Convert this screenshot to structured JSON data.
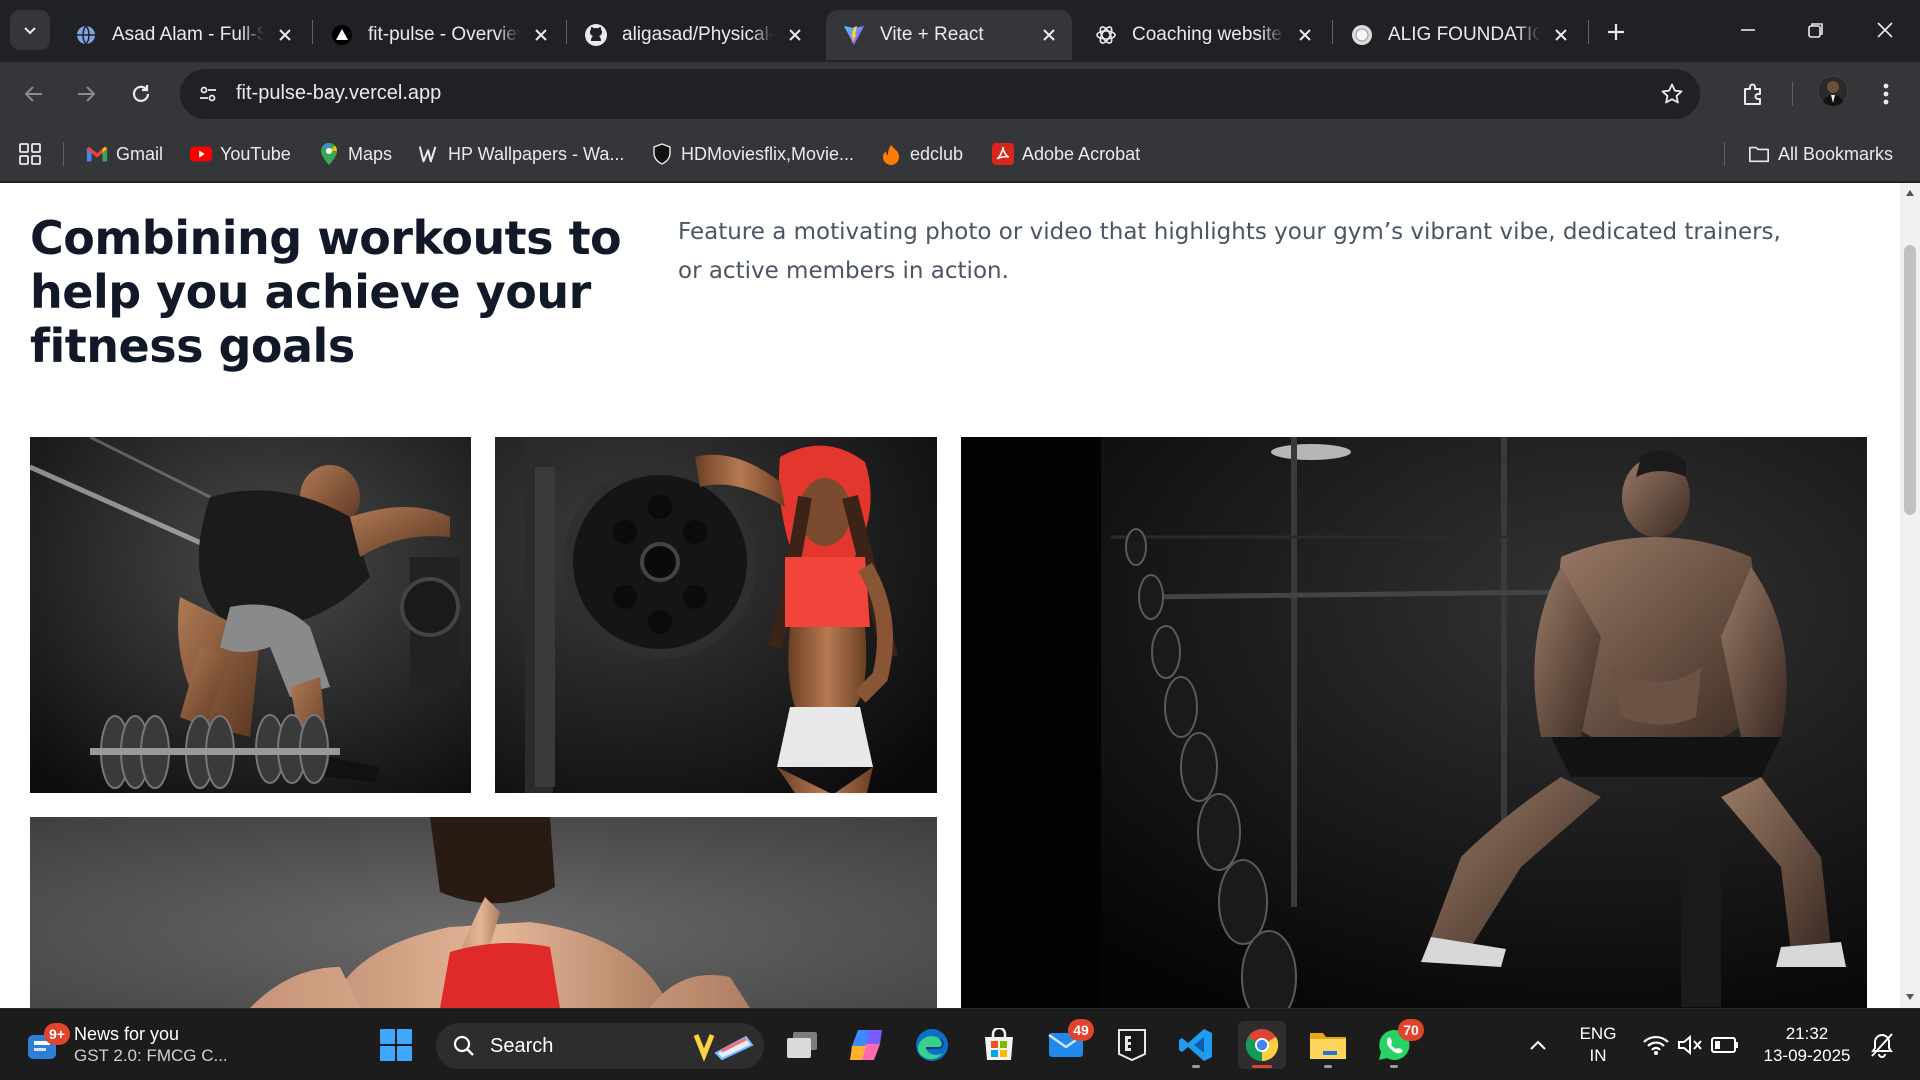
{
  "browser": {
    "tabs": [
      {
        "title": "Asad Alam - Full-Stack",
        "icon": "globe-icon",
        "active": false
      },
      {
        "title": "fit-pulse - Overview",
        "icon": "vercel-icon",
        "active": false
      },
      {
        "title": "aligasad/Physical-Fitness",
        "icon": "github-icon",
        "active": false
      },
      {
        "title": "Vite + React",
        "icon": "vite-icon",
        "active": true
      },
      {
        "title": "Coaching website ideas",
        "icon": "chatgpt-icon",
        "active": false
      },
      {
        "title": "ALIG FOUNDATION",
        "icon": "globe-icon",
        "active": false
      }
    ],
    "url": "fit-pulse-bay.vercel.app",
    "bookmarks": [
      {
        "label": "Gmail",
        "icon": "gmail-icon"
      },
      {
        "label": "YouTube",
        "icon": "youtube-icon"
      },
      {
        "label": "Maps",
        "icon": "maps-icon"
      },
      {
        "label": "HP Wallpapers - Wa...",
        "icon": "wallpaper-icon"
      },
      {
        "label": "HDMoviesflix,Movie...",
        "icon": "shield-icon"
      },
      {
        "label": "edclub",
        "icon": "edclub-icon"
      },
      {
        "label": "Adobe Acrobat",
        "icon": "acrobat-icon"
      }
    ],
    "all_bookmarks_label": "All Bookmarks"
  },
  "page": {
    "hero_title": "Combining workouts to help you achieve your fitness goals",
    "hero_description": "Feature a motivating photo or video that highlights your gym’s vibrant vibe, dedicated trainers, or active members in action.",
    "photos": [
      {
        "subject": "man lifting dumbbell"
      },
      {
        "subject": "woman in red hoodie"
      },
      {
        "subject": "muscular man seated in gym"
      },
      {
        "subject": "woman back view"
      }
    ]
  },
  "taskbar": {
    "news_title": "News for you",
    "news_subtitle": "GST 2.0: FMCG C...",
    "news_badge": "9+",
    "search_placeholder": "Search",
    "mail_badge": "49",
    "whatsapp_badge": "70",
    "language_top": "ENG",
    "language_bottom": "IN",
    "time": "21:32",
    "date": "13-09-2025"
  },
  "colors": {
    "tab_bg": "#202124",
    "toolbar_bg": "#35363a",
    "page_bg": "#ffffff",
    "heading": "#111827",
    "body_text": "#4b5563"
  }
}
